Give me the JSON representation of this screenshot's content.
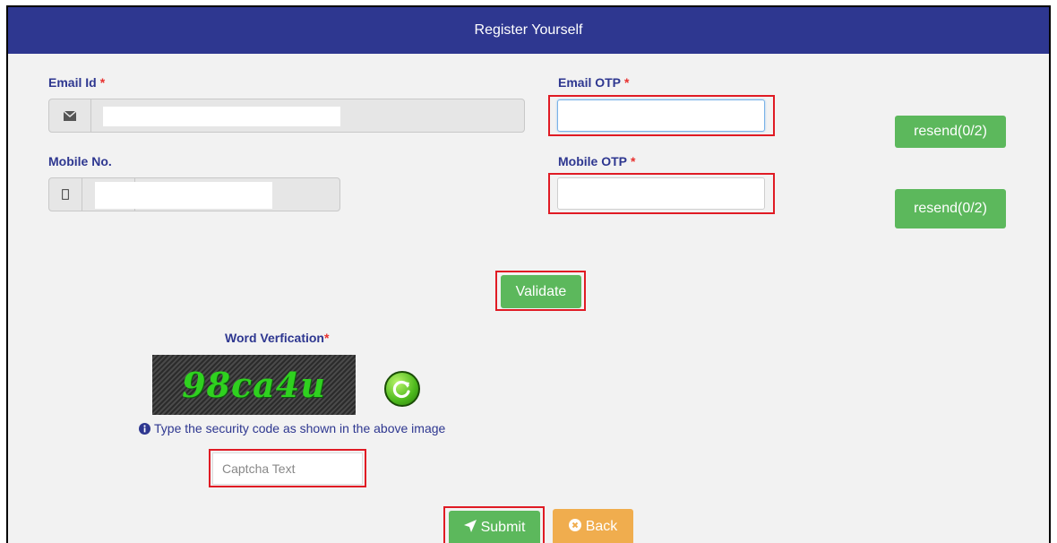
{
  "header": {
    "title": "Register Yourself"
  },
  "form": {
    "email_label": "Email Id",
    "email_otp_label": "Email OTP",
    "mobile_label": "Mobile No.",
    "mobile_otp_label": "Mobile OTP",
    "required_mark": "*",
    "resend_email_label": "resend(0/2)",
    "resend_mobile_label": "resend(0/2)",
    "validate_label": "Validate"
  },
  "captcha": {
    "heading": "Word Verfication",
    "required_mark": "*",
    "code": "98ca4u",
    "hint": "Type the security code as shown in the above image",
    "placeholder": "Captcha Text"
  },
  "actions": {
    "submit_label": "Submit",
    "back_label": "Back"
  },
  "colors": {
    "header": "#2e3790",
    "green": "#5cb85c",
    "orange": "#f0ad4e",
    "highlight": "#e01b24"
  },
  "icons": {
    "email": "envelope-icon",
    "mobile": "mobile-icon",
    "refresh": "refresh-icon",
    "info": "info-icon",
    "submit": "paper-plane-icon",
    "back": "times-circle-icon"
  }
}
